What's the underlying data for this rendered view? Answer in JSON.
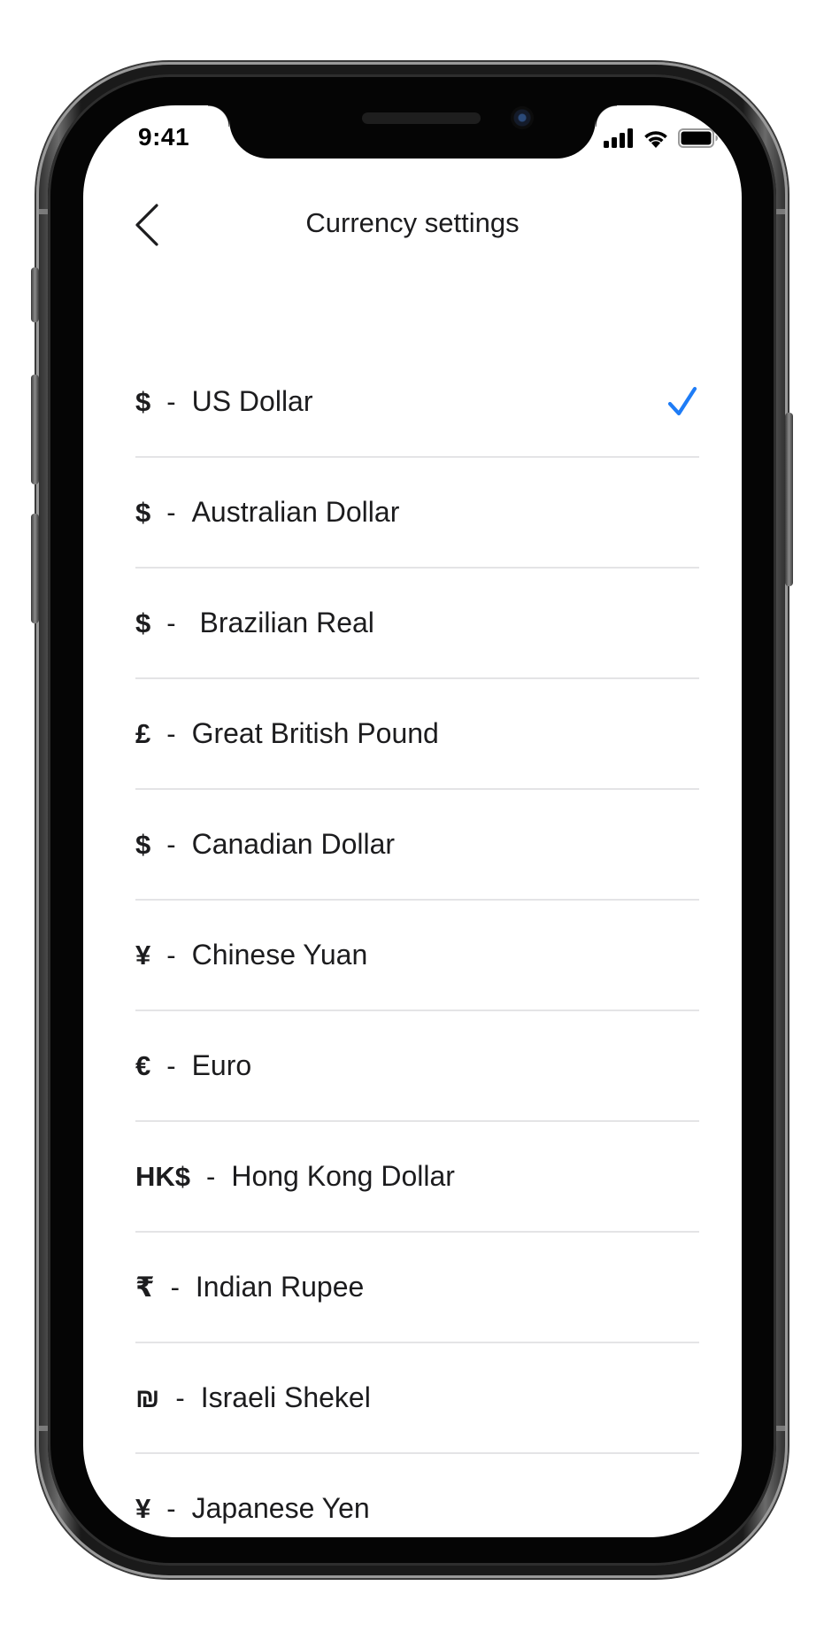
{
  "status_bar": {
    "time": "9:41"
  },
  "header": {
    "title": "Currency settings"
  },
  "currencies": [
    {
      "symbol": "$",
      "separator": "-",
      "name": "US Dollar",
      "selected": true
    },
    {
      "symbol": "$",
      "separator": "-",
      "name": "Australian Dollar",
      "selected": false
    },
    {
      "symbol": "$",
      "separator": "-",
      "name": " Brazilian Real",
      "selected": false
    },
    {
      "symbol": "£",
      "separator": "-",
      "name": "Great British Pound",
      "selected": false
    },
    {
      "symbol": "$",
      "separator": "-",
      "name": "Canadian Dollar",
      "selected": false
    },
    {
      "symbol": "¥",
      "separator": "-",
      "name": "Chinese Yuan",
      "selected": false
    },
    {
      "symbol": "€",
      "separator": "-",
      "name": "Euro",
      "selected": false
    },
    {
      "symbol": "HK$",
      "separator": "-",
      "name": "Hong Kong Dollar",
      "selected": false
    },
    {
      "symbol": "₹",
      "separator": "-",
      "name": "Indian Rupee",
      "selected": false
    },
    {
      "symbol": "₪",
      "separator": "-",
      "name": "Israeli Shekel",
      "selected": false
    },
    {
      "symbol": "¥",
      "separator": "-",
      "name": "Japanese Yen",
      "selected": false
    }
  ],
  "colors": {
    "accent": "#1e7cf6",
    "text": "#1c1c1e",
    "divider": "#e4e4e6"
  },
  "icons": {
    "back": "chevron-left-icon",
    "selected": "checkmark-icon",
    "signal": "cellular-signal-icon",
    "wifi": "wifi-icon",
    "battery": "battery-icon"
  }
}
